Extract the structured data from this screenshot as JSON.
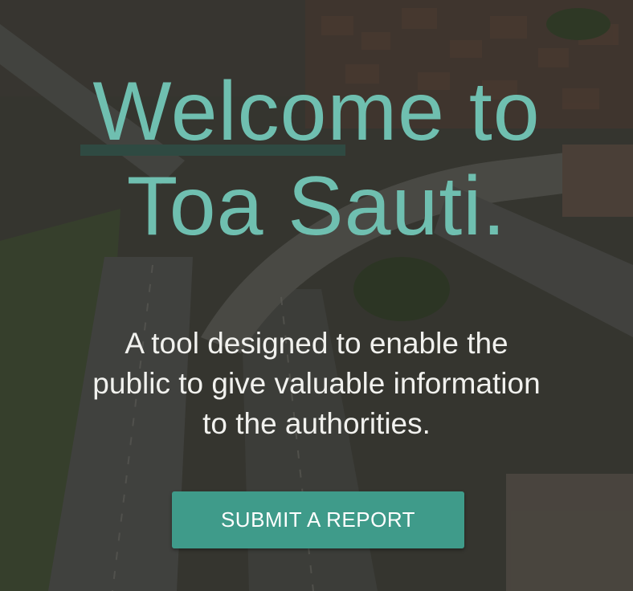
{
  "hero": {
    "title_line1": "Welcome to",
    "title_line2": "Toa Sauti.",
    "subtitle_line1": "A tool designed to enable the",
    "subtitle_line2": "public to give valuable information",
    "subtitle_line3": "to the authorities.",
    "cta_label": "SUBMIT A REPORT",
    "background_description": "aerial-highway-interchange-photo"
  },
  "colors": {
    "title": "#6fbfb0",
    "button": "#3f9b8a",
    "subtitle": "#f1f1ee"
  }
}
